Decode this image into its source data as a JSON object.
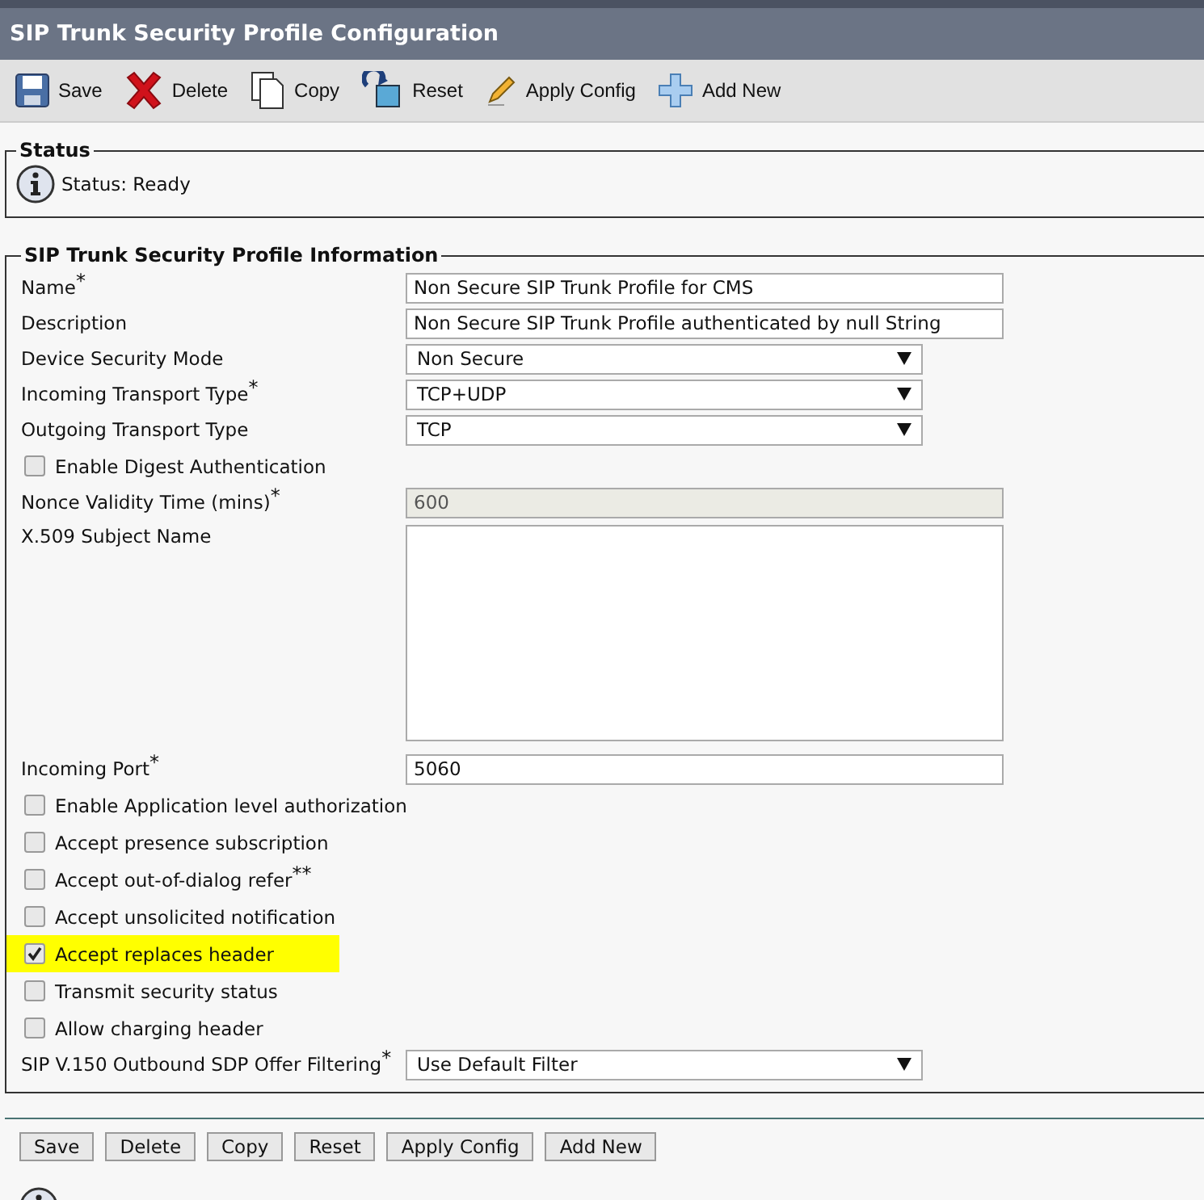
{
  "window": {
    "title": "SIP Trunk Security Profile Configuration"
  },
  "toolbar": [
    {
      "kind": "save",
      "label": "Save"
    },
    {
      "kind": "delete",
      "label": "Delete"
    },
    {
      "kind": "copy",
      "label": "Copy"
    },
    {
      "kind": "reset",
      "label": "Reset"
    },
    {
      "kind": "apply",
      "label": "Apply Config"
    },
    {
      "kind": "add",
      "label": "Add New"
    }
  ],
  "status": {
    "legend": "Status",
    "text": "Status: Ready"
  },
  "info": {
    "legend": "SIP Trunk Security Profile Information",
    "fields": [
      {
        "kind": "text",
        "label": "Name",
        "mark": "*",
        "value": "Non Secure SIP Trunk Profile for CMS",
        "disabled": false
      },
      {
        "kind": "text",
        "label": "Description",
        "value": "Non Secure SIP Trunk Profile authenticated by null String",
        "disabled": false
      },
      {
        "kind": "select",
        "label": "Device Security Mode",
        "value": "Non Secure"
      },
      {
        "kind": "select",
        "label": "Incoming Transport Type",
        "mark": "*",
        "value": "TCP+UDP"
      },
      {
        "kind": "select",
        "label": "Outgoing Transport Type",
        "value": "TCP"
      },
      {
        "kind": "checkbox",
        "label": "Enable Digest Authentication",
        "checked": false,
        "highlighted": false
      },
      {
        "kind": "text",
        "label": "Nonce Validity Time (mins)",
        "mark": "*",
        "value": "600",
        "disabled": true
      },
      {
        "kind": "textarea",
        "label": "X.509 Subject Name"
      },
      {
        "kind": "text",
        "label": "Incoming Port",
        "mark": "*",
        "value": "5060",
        "disabled": false
      },
      {
        "kind": "checkbox",
        "label": "Enable Application level authorization",
        "checked": false,
        "highlighted": false
      },
      {
        "kind": "checkbox",
        "label": "Accept presence subscription",
        "checked": false,
        "highlighted": false
      },
      {
        "kind": "checkbox",
        "label": "Accept out-of-dialog refer",
        "mark": "**",
        "checked": false,
        "highlighted": false
      },
      {
        "kind": "checkbox",
        "label": "Accept unsolicited notification",
        "checked": false,
        "highlighted": false
      },
      {
        "kind": "checkbox",
        "label": "Accept replaces header",
        "checked": true,
        "highlighted": true
      },
      {
        "kind": "checkbox",
        "label": "Transmit security status",
        "checked": false,
        "highlighted": false
      },
      {
        "kind": "checkbox",
        "label": "Allow charging header",
        "checked": false,
        "highlighted": false
      },
      {
        "kind": "select",
        "label": "SIP V.150 Outbound SDP Offer Filtering",
        "mark": "*",
        "value": "Use Default Filter"
      }
    ]
  },
  "bottom_buttons": [
    "Save",
    "Delete",
    "Copy",
    "Reset",
    "Apply Config",
    "Add New"
  ]
}
